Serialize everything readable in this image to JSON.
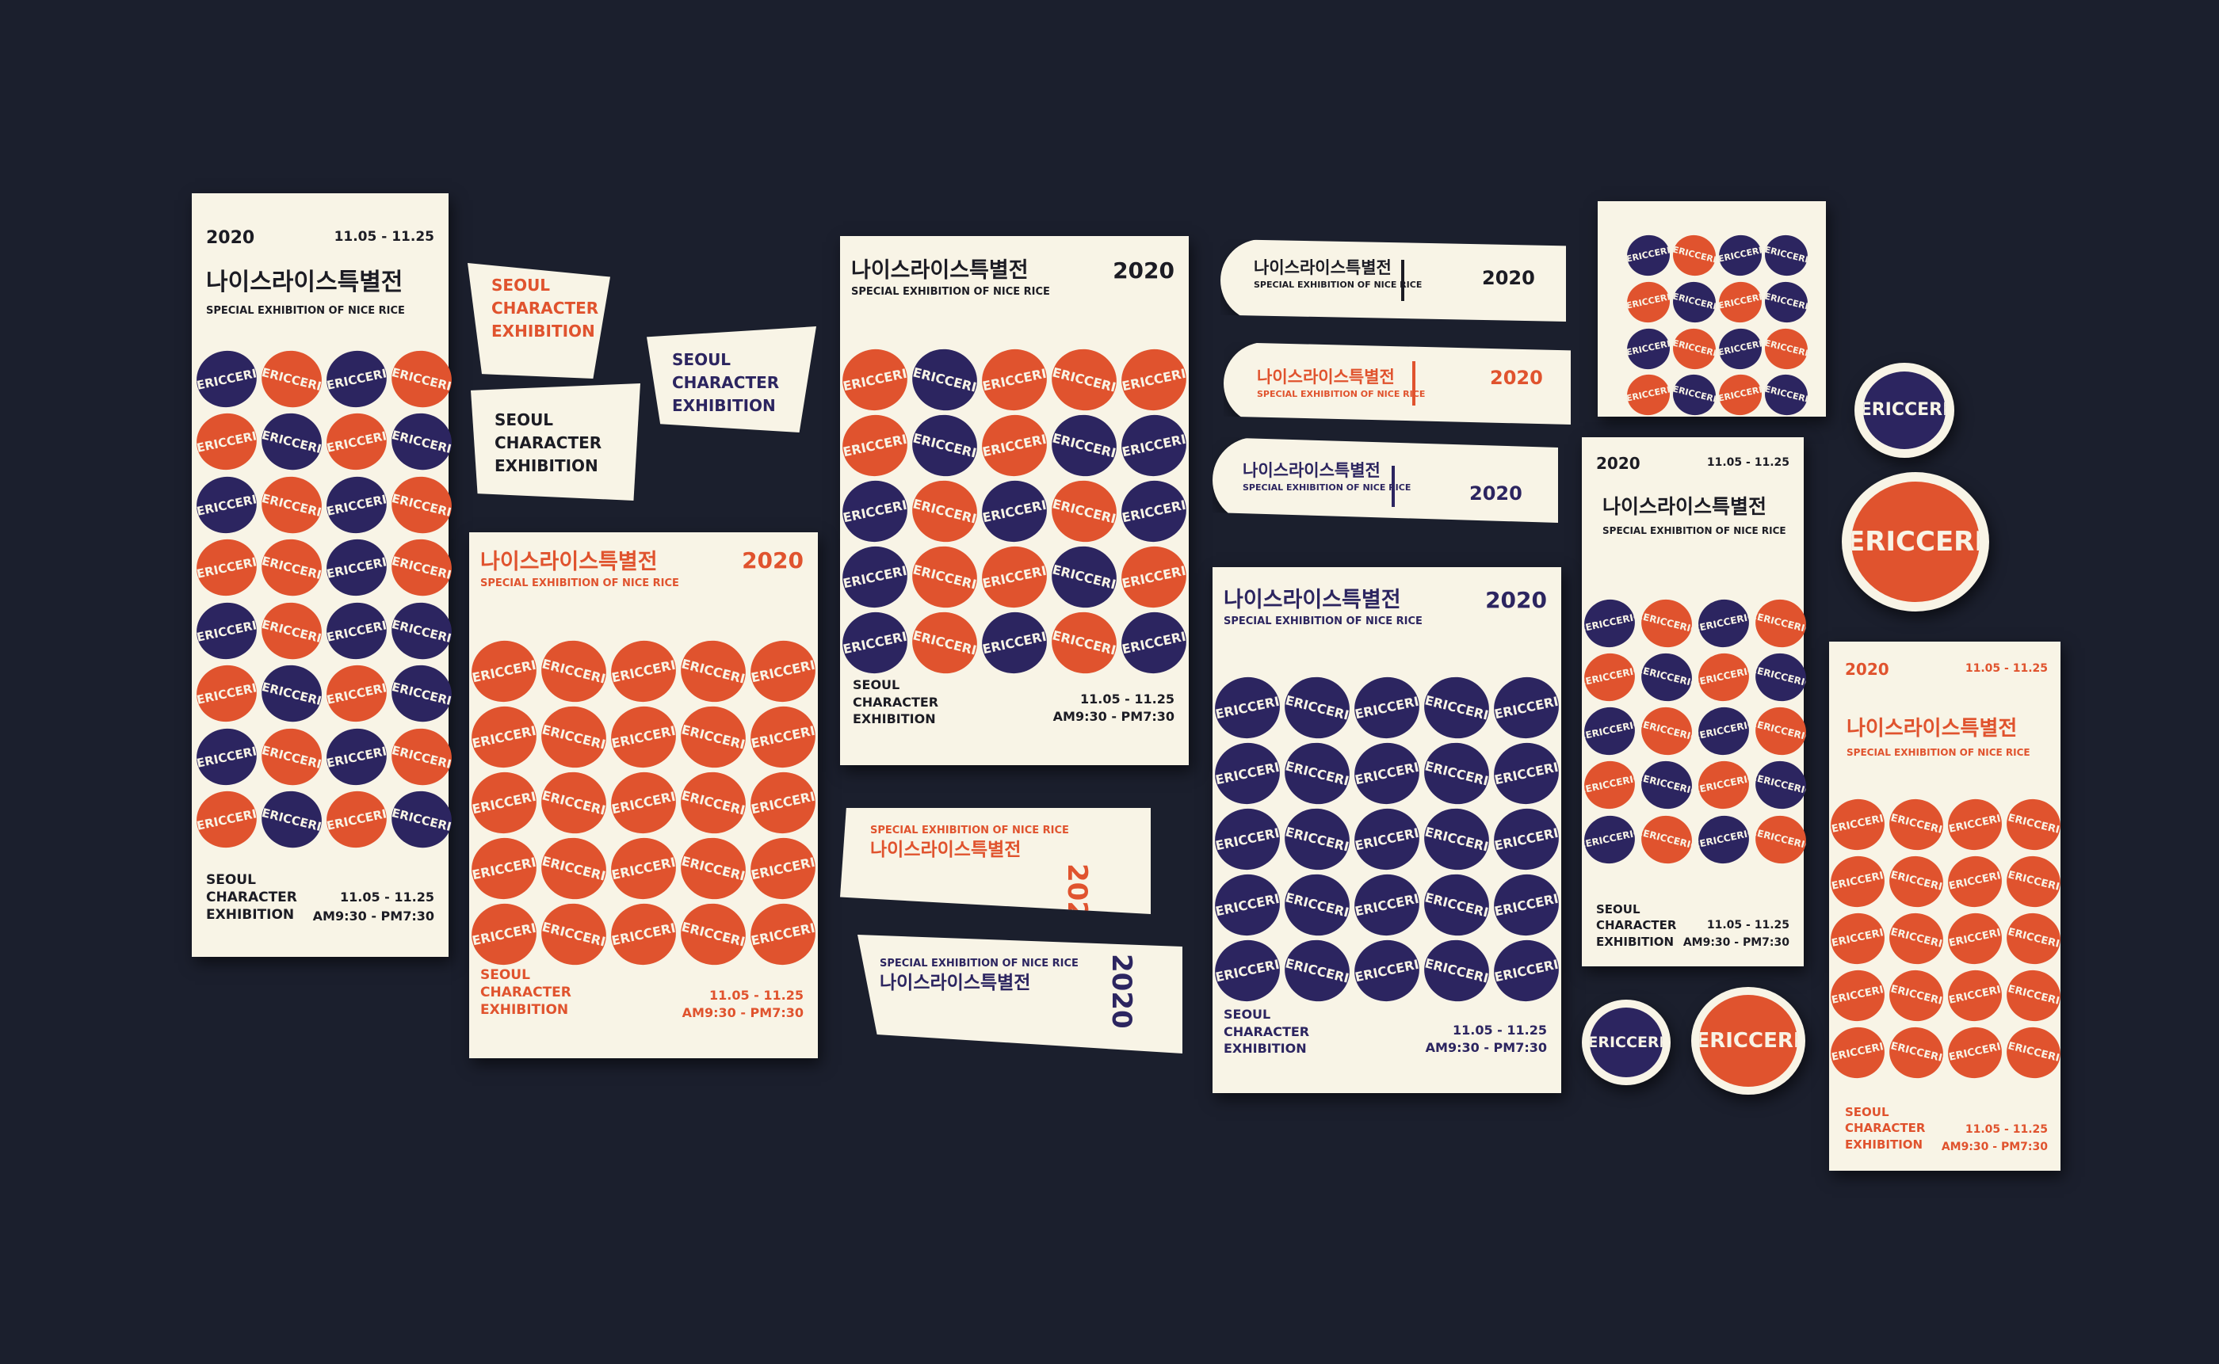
{
  "brand": {
    "year": "2020",
    "title_kr": "나이스라이스특별전",
    "subtitle_en": "SPECIAL EXHIBITION OF NICE RICE",
    "dates": "11.05 - 11.25",
    "hours": "AM9:30 - PM7:30",
    "line1": "SEOUL",
    "line2": "CHARACTER",
    "line3": "EXHIBITION",
    "ball_word": "CERIC"
  },
  "colors": {
    "background": "#1b1f2d",
    "paper": "#f8f4e6",
    "navy": "#2c2560",
    "red": "#e0532e",
    "ink": "#1c1c24"
  }
}
